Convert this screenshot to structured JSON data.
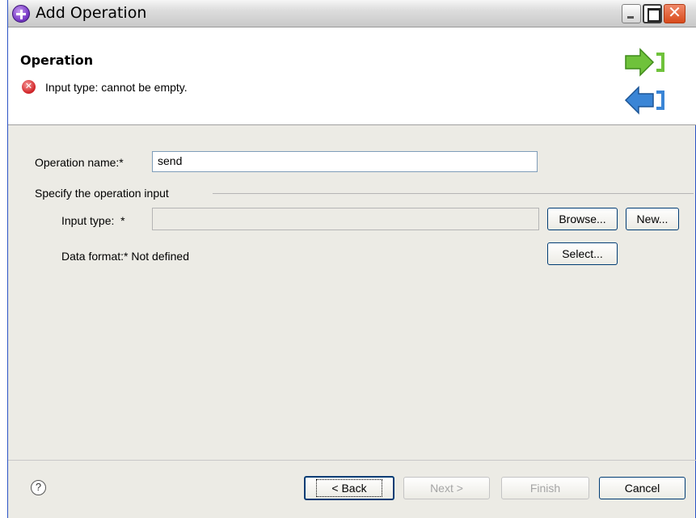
{
  "window": {
    "title": "Add Operation"
  },
  "header": {
    "title": "Operation",
    "error_message": "Input type: cannot be empty.",
    "error_glyph": "✕",
    "help_glyph": "?"
  },
  "form": {
    "operation_name_label": "Operation name:",
    "required_mark": "*",
    "operation_name_value": "send",
    "group_label": "Specify the operation input",
    "input_type_label": "Input type:",
    "input_type_value": "",
    "data_format_label": "Data format:",
    "data_format_value": "Not defined",
    "browse_label": "Browse...",
    "new_label": "New...",
    "select_label": "Select..."
  },
  "footer": {
    "back_label": "< Back",
    "next_label": "Next >",
    "finish_label": "Finish",
    "cancel_label": "Cancel"
  },
  "colors": {
    "error": "#d3272b",
    "arrow_green": "#6fc23b",
    "arrow_blue": "#3a85d6"
  },
  "icons": {
    "app": "wizard-plus-icon",
    "error": "error-circle-icon",
    "forward": "green-forward-arrow-icon",
    "back": "blue-back-arrow-icon",
    "help": "help-icon"
  }
}
